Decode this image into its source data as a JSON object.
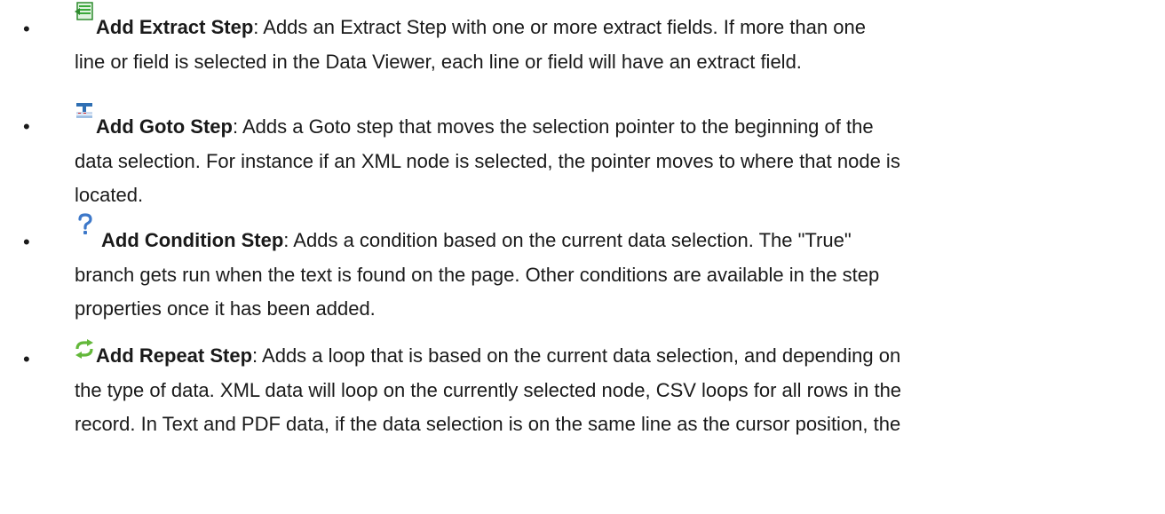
{
  "items": [
    {
      "icon": "extract-step-icon",
      "title": "Add Extract Step",
      "line1": ": Adds an Extract Step with one or more extract fields. If more than one",
      "line2": "line or field is selected in the Data Viewer, each line or field will have an extract field."
    },
    {
      "icon": "goto-step-icon",
      "title": "Add Goto Step",
      "line1": ": Adds a Goto step that moves the selection pointer to the beginning of the",
      "line2": "data selection. For instance if an XML node is selected, the pointer moves to where that node is",
      "line3": "located."
    },
    {
      "icon": "question-mark-icon",
      "title": "Add Condition Step",
      "line1": ": Adds a condition based on the current data selection. The \"True\"",
      "line2": "branch gets run when the text is found on the page. Other conditions are available in the step",
      "line3": "properties once it has been added."
    },
    {
      "icon": "repeat-arrows-icon",
      "title": "Add Repeat Step",
      "line1": ": Adds a loop that is based on the current data selection, and depending on",
      "line2": "the type of data. XML data  will loop on the currently selected node, CSV loops for all rows in the",
      "line3": "record. In Text and PDF data, if the data selection is on the same line as the cursor position, the"
    }
  ],
  "colors": {
    "text": "#1a1a1a",
    "extract_icon_green": "#3aa93a",
    "goto_icon_blue": "#2f6fb3",
    "question_icon_blue": "#3d78c9",
    "repeat_icon_green": "#63b83a"
  }
}
